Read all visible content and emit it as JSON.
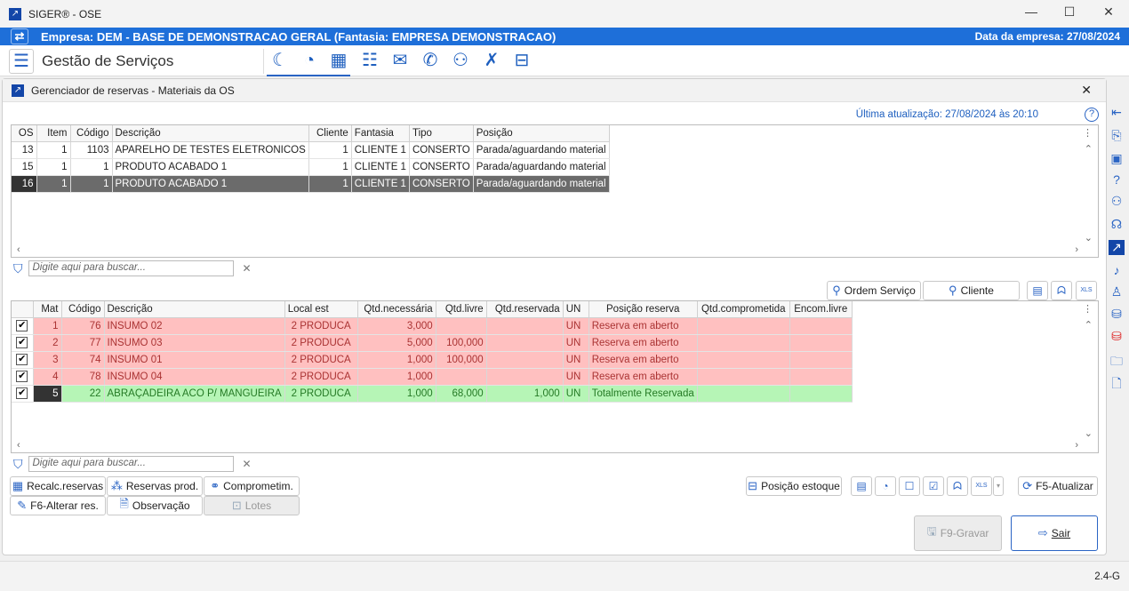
{
  "window": {
    "title": "SIGER® - OSE",
    "minimize": "—",
    "maximize": "☐",
    "close": "✕"
  },
  "company_bar": {
    "company": "Empresa: DEM - BASE DE DEMONSTRACAO GERAL (Fantasia: EMPRESA DEMONSTRACAO)",
    "date": "Data da empresa: 27/08/2024"
  },
  "nav": {
    "title": "Gestão de Serviços",
    "icons": [
      "moon-icon",
      "palette-icon",
      "calculator-icon",
      "calendar-icon",
      "mail-icon",
      "phone-icon",
      "users-icon",
      "tools-icon",
      "briefcase-icon"
    ]
  },
  "dialog": {
    "title": "Gerenciador de reservas - Materiais da OS",
    "close": "✕",
    "last_update": "Última atualização: 27/08/2024 às 20:10",
    "help": "?"
  },
  "os_grid": {
    "headers": [
      "OS",
      "Item",
      "Código",
      "Descrição",
      "Cliente",
      "Fantasia",
      "Tipo",
      "Posição"
    ],
    "rows": [
      [
        "13",
        "1",
        "1103",
        "APARELHO DE TESTES ELETRONICOS",
        "1",
        "CLIENTE 1",
        "CONSERTO",
        "Parada/aguardando material"
      ],
      [
        "15",
        "1",
        "1",
        "PRODUTO ACABADO 1",
        "1",
        "CLIENTE 1",
        "CONSERTO",
        "Parada/aguardando material"
      ],
      [
        "16",
        "1",
        "1",
        "PRODUTO ACABADO 1",
        "1",
        "CLIENTE 1",
        "CONSERTO",
        "Parada/aguardando material"
      ]
    ],
    "selected_row": 2,
    "search_placeholder": "Digite aqui para buscar..."
  },
  "mid_toolbar": {
    "ordem_servico": "Ordem Serviço",
    "cliente": "Cliente",
    "xls": "XLS"
  },
  "mat_grid": {
    "headers": [
      "",
      "Mat",
      "Código",
      "Descrição",
      "Local est",
      "Qtd.necessária",
      "Qtd.livre",
      "Qtd.reservada",
      "UN",
      "Posição reserva",
      "Qtd.comprometida",
      "Encom.livre"
    ],
    "rows": [
      {
        "checked": true,
        "status": "red",
        "cells": [
          "1",
          "76",
          "INSUMO 02",
          "2 PRODUCA",
          "3,000",
          "",
          "",
          "UN",
          "Reserva em aberto",
          "",
          ""
        ]
      },
      {
        "checked": true,
        "status": "red",
        "cells": [
          "2",
          "77",
          "INSUMO 03",
          "2 PRODUCA",
          "5,000",
          "100,000",
          "",
          "UN",
          "Reserva em aberto",
          "",
          ""
        ]
      },
      {
        "checked": true,
        "status": "red",
        "cells": [
          "3",
          "74",
          "INSUMO 01",
          "2 PRODUCA",
          "1,000",
          "100,000",
          "",
          "UN",
          "Reserva em aberto",
          "",
          ""
        ]
      },
      {
        "checked": true,
        "status": "red",
        "cells": [
          "4",
          "78",
          "INSUMO 04",
          "2 PRODUCA",
          "1,000",
          "",
          "",
          "UN",
          "Reserva em aberto",
          "",
          ""
        ]
      },
      {
        "checked": true,
        "status": "green",
        "cells": [
          "5",
          "22",
          "ABRAÇADEIRA ACO P/ MANGUEIRA",
          "2 PRODUCA",
          "1,000",
          "68,000",
          "1,000",
          "UN",
          "Totalmente Reservada",
          "",
          ""
        ]
      }
    ],
    "search_placeholder": "Digite aqui para buscar..."
  },
  "actions": {
    "recalc": "Recalc.reservas",
    "reservas_prod": "Reservas prod.",
    "comprometim": "Comprometim.",
    "alterar": "F6-Alterar res.",
    "observacao": "Observação",
    "lotes": "Lotes",
    "posicao_estoque": "Posição estoque",
    "atualizar": "F5-Atualizar",
    "gravar": "F9-Gravar",
    "sair": "Sair"
  },
  "status_bar": {
    "version": "2.4-G"
  }
}
